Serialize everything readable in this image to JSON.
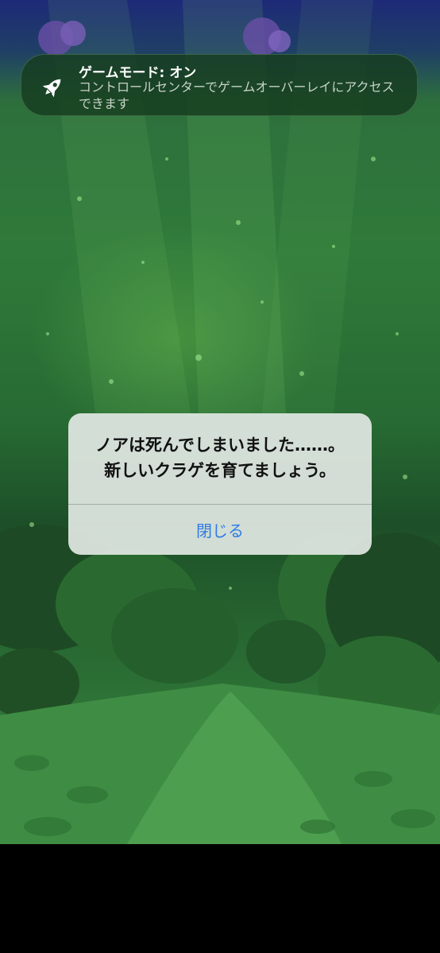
{
  "notification": {
    "icon": "rocket-icon",
    "title": "ゲームモード: オン",
    "message": "コントロールセンターでゲームオーバーレイにアクセスできます"
  },
  "alert": {
    "message": "ノアは死んでしまいました……。\n新しいクラゲを育てましょう。",
    "close_label": "閉じる",
    "button_color": "#2f7be5"
  }
}
